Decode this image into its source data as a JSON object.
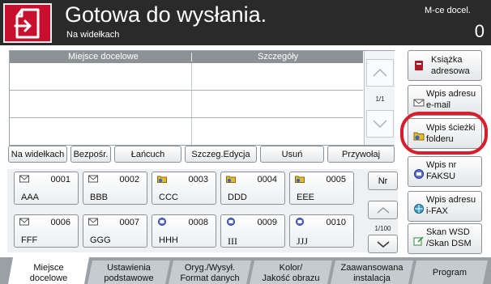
{
  "header": {
    "title": "Gotowa do wysłania.",
    "subtitle": "Na widełkach",
    "dest_label": "M-ce docel.",
    "dest_count": "0"
  },
  "table": {
    "col_dest": "Miejsce docelowe",
    "col_details": "Szczegóły",
    "page": "1/1"
  },
  "actions": [
    "Na widełkach",
    "Bezpośr.",
    "Łańcuch",
    "Szczeg.Edycja",
    "Usuń",
    "Przywołaj"
  ],
  "keys": [
    {
      "num": "0001",
      "name": "AAA",
      "icon": "email-icon"
    },
    {
      "num": "0002",
      "name": "BBB",
      "icon": "email-icon"
    },
    {
      "num": "0003",
      "name": "CCC",
      "icon": "folder-icon"
    },
    {
      "num": "0004",
      "name": "DDD",
      "icon": "folder-icon"
    },
    {
      "num": "0005",
      "name": "EEE",
      "icon": "folder-icon"
    },
    {
      "num": "0006",
      "name": "FFF",
      "icon": "email-icon"
    },
    {
      "num": "0007",
      "name": "GGG",
      "icon": "email-icon"
    },
    {
      "num": "0008",
      "name": "HHH",
      "icon": "fax-icon"
    },
    {
      "num": "0009",
      "name": "III",
      "icon": "fax-icon"
    },
    {
      "num": "0010",
      "name": "JJJ",
      "icon": "fax-icon"
    }
  ],
  "key_panel": {
    "nr": "Nr",
    "page": "1/100"
  },
  "side_buttons": [
    {
      "l1": "Książka",
      "l2": "adresowa",
      "icon": "address-book-icon"
    },
    {
      "l1": "Wpis adresu",
      "l2": "e-mail",
      "icon": "email-icon"
    },
    {
      "l1": "Wpis ścieżki",
      "l2": "folderu",
      "icon": "folder-icon"
    },
    {
      "l1": "Wpis nr",
      "l2": "FAKSU",
      "icon": "fax-icon"
    },
    {
      "l1": "Wpis adresu",
      "l2": "i-FAX",
      "icon": "ifax-icon"
    },
    {
      "l1": "Skan WSD",
      "l2": "/Skan DSM",
      "icon": "wsd-scan-icon"
    }
  ],
  "tabs": [
    {
      "l1": "Miejsce",
      "l2": "docelowe"
    },
    {
      "l1": "Ustawienia",
      "l2": "podstawowe"
    },
    {
      "l1": "Oryg./Wysył.",
      "l2": "Format danych"
    },
    {
      "l1": "Kolor/",
      "l2": "Jakość obrazu"
    },
    {
      "l1": "Zaawansowana",
      "l2": "instalacja"
    },
    {
      "l1": "Program",
      "l2": ""
    }
  ],
  "colors": {
    "accent": "#c8102e",
    "header": "#2a2a2a",
    "highlight": "#d81e2c"
  }
}
